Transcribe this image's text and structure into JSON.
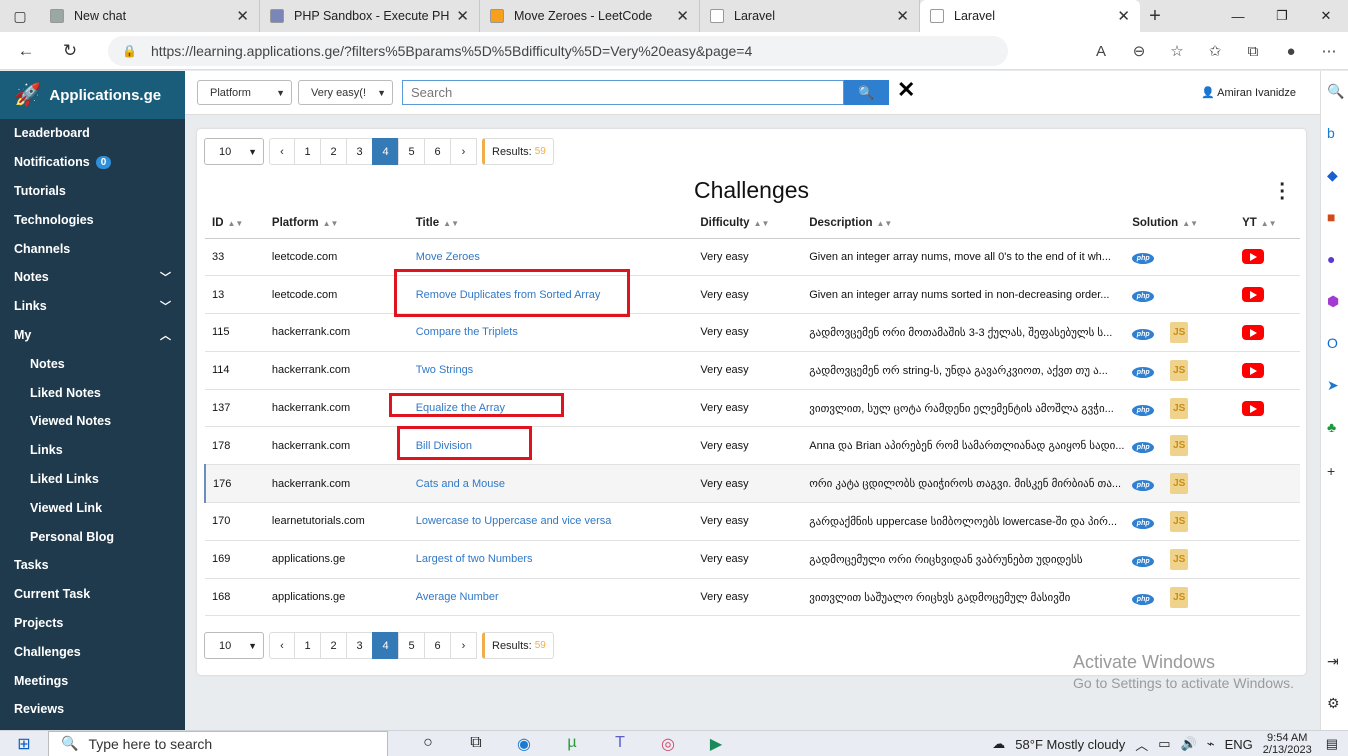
{
  "browser": {
    "tabs": [
      {
        "title": "New chat",
        "fav_color": "#9aa7a3"
      },
      {
        "title": "PHP Sandbox - Execute PHP",
        "fav_color": "#7a86b8"
      },
      {
        "title": "Move Zeroes - LeetCode",
        "fav_color": "#f89f1b"
      },
      {
        "title": "Laravel",
        "fav_color": "#ffffff"
      },
      {
        "title": "Laravel",
        "fav_color": "#ffffff"
      }
    ],
    "url": "https://learning.applications.ge/?filters%5Bparams%5D%5Bdifficulty%5D=Very%20easy&page=4"
  },
  "sidebar": {
    "brand": "Applications.ge",
    "notifications_count": "0",
    "items": [
      {
        "label": "Leaderboard"
      },
      {
        "label": "Notifications"
      },
      {
        "label": "Tutorials"
      },
      {
        "label": "Technologies"
      },
      {
        "label": "Channels"
      },
      {
        "label": "Notes"
      },
      {
        "label": "Links"
      },
      {
        "label": "My"
      },
      {
        "label": "Notes"
      },
      {
        "label": "Liked Notes"
      },
      {
        "label": "Viewed Notes"
      },
      {
        "label": "Links"
      },
      {
        "label": "Liked Links"
      },
      {
        "label": "Viewed Link"
      },
      {
        "label": "Personal Blog"
      },
      {
        "label": "Tasks"
      },
      {
        "label": "Current Task"
      },
      {
        "label": "Projects"
      },
      {
        "label": "Challenges"
      },
      {
        "label": "Meetings"
      },
      {
        "label": "Reviews"
      }
    ]
  },
  "topbar": {
    "platform_select": "Platform",
    "difficulty_select": "Very easy(!",
    "search_placeholder": "Search",
    "user": "Amiran Ivanidze"
  },
  "pager": {
    "page_size": "10",
    "prev": "‹",
    "next": "›",
    "pages": [
      "1",
      "2",
      "3",
      "4",
      "5",
      "6"
    ],
    "active_page": "4",
    "results_label": "Results:",
    "results_count": "59"
  },
  "page_title": "Challenges",
  "table": {
    "headers": [
      "ID",
      "Platform",
      "Title",
      "Difficulty",
      "Description",
      "Solution",
      "YT"
    ],
    "rows": [
      {
        "id": "33",
        "platform": "leetcode.com",
        "title": "Move Zeroes",
        "difficulty": "Very easy",
        "description": "Given an integer array nums, move all 0's to the end of it wh...",
        "php": true,
        "js": false,
        "yt": true
      },
      {
        "id": "13",
        "platform": "leetcode.com",
        "title": "Remove Duplicates from Sorted Array",
        "difficulty": "Very easy",
        "description": "Given an integer array nums sorted in non-decreasing order...",
        "php": true,
        "js": false,
        "yt": true
      },
      {
        "id": "115",
        "platform": "hackerrank.com",
        "title": "Compare the Triplets",
        "difficulty": "Very easy",
        "description": "გადმოვცემენ ორი მოთამაშის 3-3 ქულას, შეფასებულს ს...",
        "php": true,
        "js": true,
        "yt": true
      },
      {
        "id": "114",
        "platform": "hackerrank.com",
        "title": "Two Strings",
        "difficulty": "Very easy",
        "description": "გადმოვცემენ ორ string-ს, უნდა გავარკვიოთ, აქვთ თუ ა...",
        "php": true,
        "js": true,
        "yt": true
      },
      {
        "id": "137",
        "platform": "hackerrank.com",
        "title": "Equalize the Array",
        "difficulty": "Very easy",
        "description": "ვითვლით, სულ ცოტა რამდენი ელემენტის ამოშლა გვჭი...",
        "php": true,
        "js": true,
        "yt": true
      },
      {
        "id": "178",
        "platform": "hackerrank.com",
        "title": "Bill Division",
        "difficulty": "Very easy",
        "description": "Anna და Brian აპირებენ რომ სამართლიანად გაიყონ სადი...",
        "php": true,
        "js": true,
        "yt": false
      },
      {
        "id": "176",
        "platform": "hackerrank.com",
        "title": "Cats and a Mouse",
        "difficulty": "Very easy",
        "description": "ორი კატა ცდილობს დაიჭიროს თაგვი. მისკენ მირბიან თა...",
        "php": true,
        "js": true,
        "yt": false
      },
      {
        "id": "170",
        "platform": "learnetutorials.com",
        "title": "Lowercase to Uppercase and vice versa",
        "difficulty": "Very easy",
        "description": "გარდაქმნის uppercase სიმბოლოებს lowercase-ში და პირ...",
        "php": true,
        "js": true,
        "yt": false
      },
      {
        "id": "169",
        "platform": "applications.ge",
        "title": "Largest of two Numbers",
        "difficulty": "Very easy",
        "description": "გადმოცემული ორი რიცხვიდან ვაბრუნებთ უდიდესს",
        "php": true,
        "js": true,
        "yt": false
      },
      {
        "id": "168",
        "platform": "applications.ge",
        "title": "Average Number",
        "difficulty": "Very easy",
        "description": "ვითვლით საშუალო რიცხვს გადმოცემულ მასივში",
        "php": true,
        "js": true,
        "yt": false
      }
    ]
  },
  "watermark": {
    "line1": "Activate Windows",
    "line2": "Go to Settings to activate Windows."
  },
  "taskbar": {
    "search_placeholder": "Type here to search",
    "weather": "58°F  Mostly cloudy",
    "lang": "ENG",
    "time": "9:54 AM",
    "date": "2/13/2023"
  },
  "colors": {
    "accent": "#337ab7",
    "sidebar": "#1f3a4d",
    "highlight_box": "#e0141e",
    "results_badge": "#f0ad4e"
  }
}
